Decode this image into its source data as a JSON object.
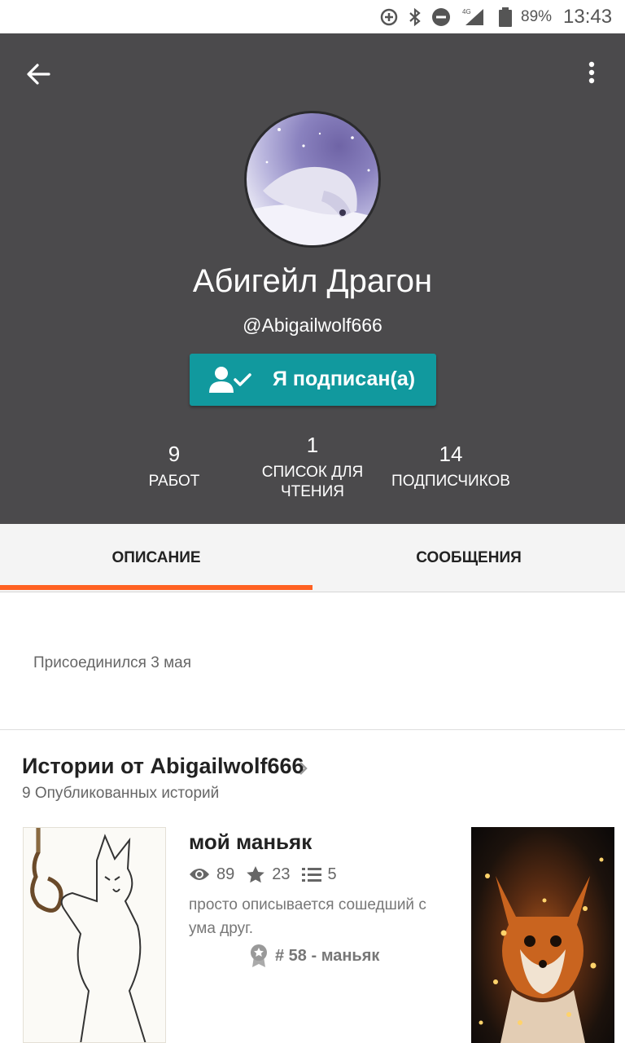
{
  "status_bar": {
    "battery_percent": "89%",
    "time": "13:43",
    "icons": [
      "data-saver-icon",
      "bluetooth-icon",
      "do-not-disturb-icon",
      "4g-signal-icon",
      "battery-icon"
    ]
  },
  "header": {
    "back_icon": "arrow-left-icon",
    "more_icon": "more-vertical-icon",
    "display_name": "Абигейл Драгон",
    "username": "@Abigailwolf666",
    "follow_button": {
      "icon": "person-check-icon",
      "label": "Я подписан(а)"
    },
    "stats": {
      "works": {
        "value": "9",
        "label": "РАБОТ"
      },
      "reading_list": {
        "value": "1",
        "label_line1": "СПИСОК ДЛЯ",
        "label_line2": "ЧТЕНИЯ"
      },
      "followers": {
        "value": "14",
        "label": "ПОДПИСЧИКОВ"
      }
    }
  },
  "tabs": [
    {
      "label": "ОПИСАНИЕ",
      "active": true
    },
    {
      "label": "СООБЩЕНИЯ",
      "active": false
    }
  ],
  "accent_color": "#ff6122",
  "button_color": "#11999e",
  "about": {
    "joined": "Присоединился 3 мая"
  },
  "stories": {
    "title": "Истории от Abigailwolf666",
    "subtitle": "9 Опубликованных историй",
    "items": [
      {
        "title": "мой маньяк",
        "views": "89",
        "votes": "23",
        "parts": "5",
        "description": "просто описывается сошедший с ума друг.",
        "rank": "# 58 - маньяк"
      }
    ]
  }
}
